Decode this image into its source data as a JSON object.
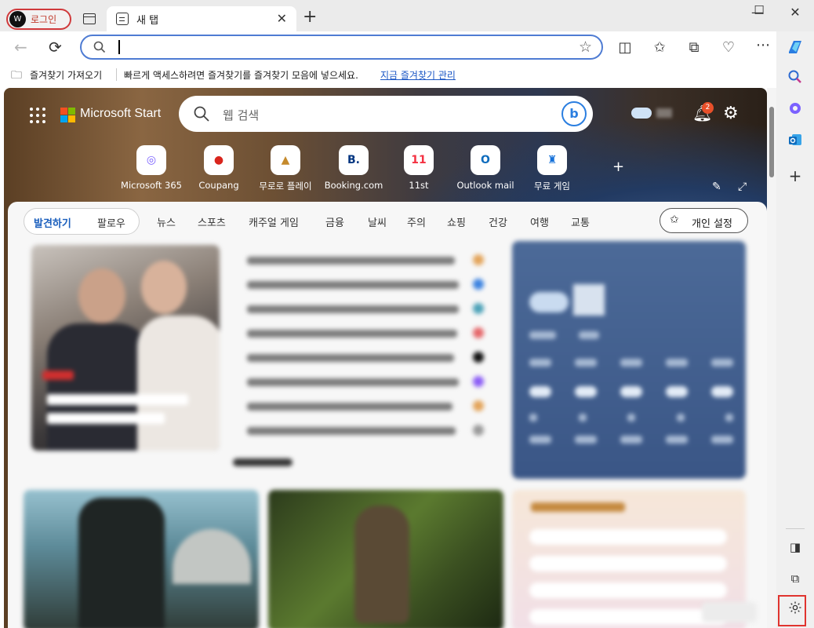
{
  "titlebar": {
    "login_avatar": "W",
    "login_label": "로그인",
    "tab_title": "새 탭",
    "tab_close": "✕",
    "new_tab": "+",
    "minimize": "—",
    "maximize": "☐",
    "close": "✕"
  },
  "navbar": {
    "back": "←",
    "refresh": "⟳",
    "address_value": "",
    "favorite_star": "☆",
    "toolbar_icons": [
      "split-screen-icon",
      "favorites-icon",
      "collections-icon",
      "browser-essentials-icon",
      "more-icon",
      "copilot-icon"
    ]
  },
  "favbar": {
    "import_label": "즐겨찾기 가져오기",
    "prompt_text": "빠르게 액세스하려면 즐겨찾기를 즐겨찾기 모음에 넣으세요.",
    "manage_link": "지금 즐겨찾기 관리"
  },
  "sidebar": {
    "icons": [
      "search-icon",
      "copilot-app-icon",
      "outlook-icon",
      "add-icon",
      "sidebar-toggle-icon",
      "external-icon",
      "settings-icon"
    ]
  },
  "start": {
    "brand": "Microsoft Start",
    "search_placeholder": "웹 검색",
    "bing_label": "b",
    "notification_count": "2",
    "quick_links": [
      {
        "label": "Microsoft 365",
        "glyph": "◎",
        "color": "#7b61ff"
      },
      {
        "label": "Coupang",
        "glyph": "●",
        "color": "#d9251d"
      },
      {
        "label": "무로로 플레이",
        "glyph": "▲",
        "color": "#c58a2c"
      },
      {
        "label": "Booking.com",
        "glyph": "B.",
        "color": "#003580"
      },
      {
        "label": "11st",
        "glyph": "11",
        "color": "#f43142"
      },
      {
        "label": "Outlook mail",
        "glyph": "O",
        "color": "#0f6cbd"
      },
      {
        "label": "무료 게임",
        "glyph": "♜",
        "color": "#1570d8"
      }
    ],
    "add_shortcut": "+"
  },
  "feed": {
    "discover": "발견하기",
    "follow": "팔로우",
    "categories": [
      "뉴스",
      "스포츠",
      "캐주얼 게임",
      "금융",
      "날씨",
      "주의",
      "쇼핑",
      "건강",
      "여행",
      "교통"
    ],
    "personalize": "개인 설정"
  },
  "colors": {
    "accent": "#1b5fbd",
    "highlight": "#e0342f",
    "address_border": "#4f7cd3"
  }
}
